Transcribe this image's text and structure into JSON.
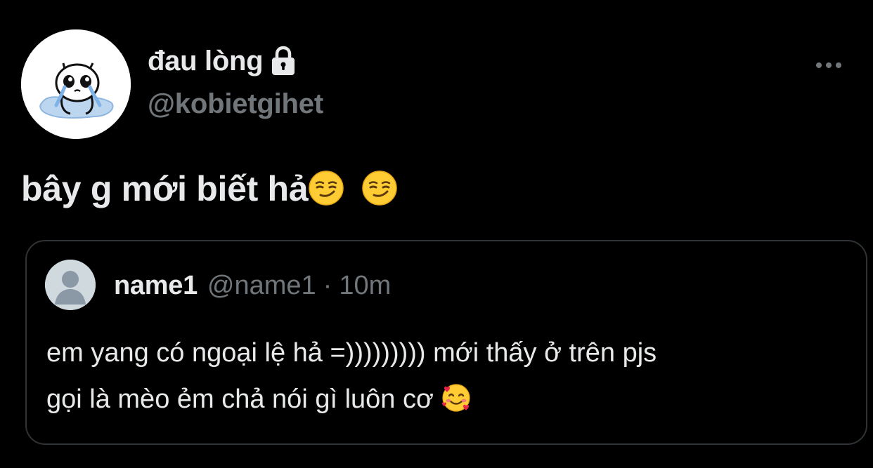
{
  "author": {
    "display_name": "đau lòng",
    "handle": "@kobietgihet",
    "avatar_icon": "crying-doodle-avatar",
    "lock_icon": "lock-icon"
  },
  "actions": {
    "more_icon": "more-dots-icon"
  },
  "tweet": {
    "text": "bây g mới biết hả",
    "emojis": [
      "smirking-face-emoji",
      "smirking-face-emoji"
    ]
  },
  "quote": {
    "name": "name1",
    "handle": "@name1",
    "separator": "·",
    "time": "10m",
    "avatar_icon": "default-profile-avatar",
    "text_line1": "em yang có ngoại lệ hả =))))))))) mới thấy ở trên pjs",
    "text_line2": "gọi là mèo ẻm chả nói gì luôn cơ",
    "emoji": "smiling-face-with-hearts-emoji"
  },
  "colors": {
    "background": "#000000",
    "primary_text": "#e7e9ea",
    "secondary_text": "#71767b",
    "border": "#2f3336",
    "default_avatar_bg": "#cfd9de"
  }
}
